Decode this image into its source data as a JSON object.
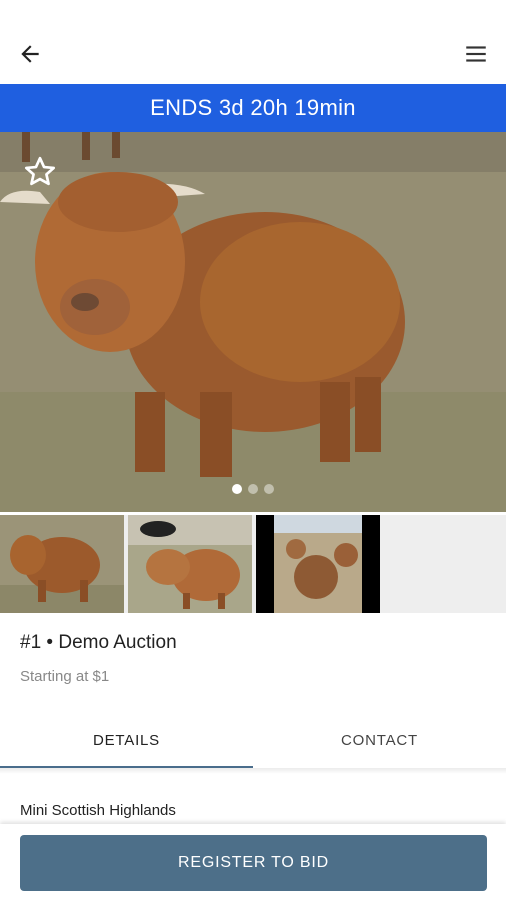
{
  "header": {
    "back_icon": "arrow-left-icon",
    "menu_icon": "hamburger-menu-icon"
  },
  "banner": {
    "text": "ENDS 3d 20h 19min",
    "color": "#1f5fe0"
  },
  "gallery": {
    "favorite_icon": "star-outline-icon",
    "pager": {
      "count": 3,
      "active": 1
    },
    "thumbnails": [
      "thumbnail-1",
      "thumbnail-2",
      "thumbnail-3"
    ]
  },
  "lot": {
    "title": "#1 • Demo Auction",
    "starting": "Starting at $1"
  },
  "tabs": [
    {
      "label": "DETAILS",
      "active": true
    },
    {
      "label": "CONTACT",
      "active": false
    }
  ],
  "details": {
    "text": "Mini Scottish Highlands"
  },
  "cta": {
    "label": "REGISTER TO BID",
    "color": "#4d6f89"
  }
}
